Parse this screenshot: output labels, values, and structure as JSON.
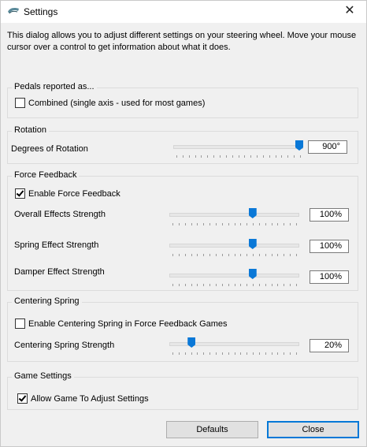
{
  "window": {
    "title": "Settings",
    "close_glyph": "✕"
  },
  "intro": "This dialog allows you to adjust different settings on your steering wheel.  Move your mouse cursor over a control to get information about what it does.",
  "pedals": {
    "group_label": "Pedals reported as...",
    "combined_label": "Combined (single axis - used for most games)",
    "combined_checked": false
  },
  "rotation": {
    "group_label": "Rotation",
    "degrees_label": "Degrees of Rotation",
    "degrees_value": "900°",
    "slider_fraction": 1.0
  },
  "force_feedback": {
    "group_label": "Force Feedback",
    "enable_label": "Enable Force Feedback",
    "enable_checked": true,
    "overall": {
      "label": "Overall Effects Strength",
      "value": "100%",
      "fraction": 0.65
    },
    "spring": {
      "label": "Spring Effect Strength",
      "value": "100%",
      "fraction": 0.65
    },
    "damper": {
      "label": "Damper Effect Strength",
      "value": "100%",
      "fraction": 0.65
    }
  },
  "centering": {
    "group_label": "Centering Spring",
    "enable_label": "Enable Centering Spring in Force Feedback Games",
    "enable_checked": false,
    "strength_label": "Centering Spring Strength",
    "strength_value": "20%",
    "fraction": 0.15
  },
  "game": {
    "group_label": "Game Settings",
    "allow_label": "Allow Game To Adjust Settings",
    "allow_checked": true
  },
  "buttons": {
    "defaults": "Defaults",
    "close": "Close"
  },
  "colors": {
    "accent": "#0a78d7",
    "background": "#f0f0f0"
  }
}
